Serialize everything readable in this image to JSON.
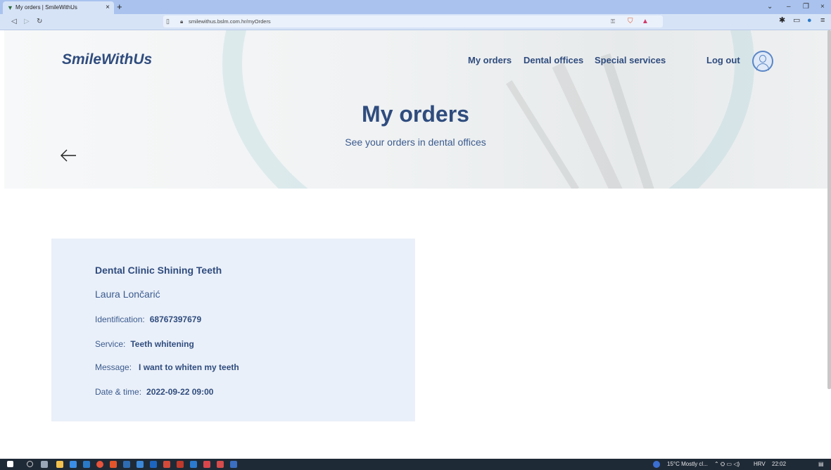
{
  "browser": {
    "tab_title": "My orders | SmileWithUs",
    "new_tab": "+",
    "url": "smilewithus.bslm.com.hr/myOrders"
  },
  "header": {
    "brand": "SmileWithUs",
    "nav": [
      "My orders",
      "Dental offices",
      "Special services"
    ],
    "logout": "Log out"
  },
  "hero": {
    "title": "My orders",
    "subtitle": "See your orders in dental offices"
  },
  "order": {
    "clinic": "Dental Clinic Shining Teeth",
    "patient": "Laura Lončarić",
    "fields": [
      {
        "label": "Identification:",
        "value": "68767397679"
      },
      {
        "label": "Service:",
        "value": "Teeth whitening"
      },
      {
        "label": "Message:",
        "value": "I want to whiten my teeth"
      },
      {
        "label": "Date & time:",
        "value": "2022-09-22 09:00"
      }
    ]
  },
  "taskbar": {
    "weather": "15°C  Mostly cl...",
    "lang": "HRV",
    "time": "22:02"
  },
  "icons": {
    "back": "arrow-left-icon",
    "avatar": "user-icon",
    "colors": {
      "primary": "#2f4c7e",
      "card_bg": "#eaf0f9"
    }
  }
}
